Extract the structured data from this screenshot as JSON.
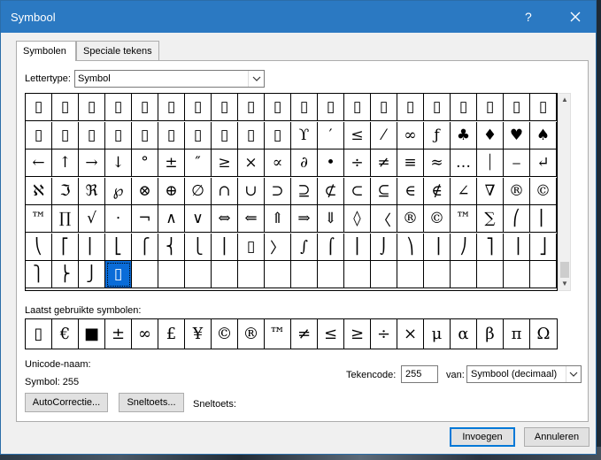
{
  "window": {
    "title": "Symbool",
    "help": "?"
  },
  "tabs": [
    {
      "label": "Symbolen",
      "active": true
    },
    {
      "label": "Speciale tekens",
      "active": false
    }
  ],
  "font": {
    "label": "Lettertype:",
    "value": "Symbol"
  },
  "grid": {
    "rows": [
      [
        "▯",
        "▯",
        "▯",
        "▯",
        "▯",
        "▯",
        "▯",
        "▯",
        "▯",
        "▯",
        "▯",
        "▯",
        "▯",
        "▯",
        "▯",
        "▯",
        "▯",
        "▯",
        "▯",
        "▯"
      ],
      [
        "▯",
        "▯",
        "▯",
        "▯",
        "▯",
        "▯",
        "▯",
        "▯",
        "▯",
        "▯",
        "ϒ",
        "′",
        "≤",
        "⁄",
        "∞",
        "ƒ",
        "♣",
        "♦",
        "♥",
        "♠",
        "↔"
      ],
      [
        "←",
        "↑",
        "→",
        "↓",
        "°",
        "±",
        "″",
        "≥",
        "×",
        "∝",
        "∂",
        "•",
        "÷",
        "≠",
        "≡",
        "≈",
        "…",
        "⏐",
        "⎯",
        "↵"
      ],
      [
        "ℵ",
        "ℑ",
        "ℜ",
        "℘",
        "⊗",
        "⊕",
        "∅",
        "∩",
        "∪",
        "⊃",
        "⊇",
        "⊄",
        "⊂",
        "⊆",
        "∈",
        "∉",
        "∠",
        "∇",
        "®",
        "©"
      ],
      [
        "™",
        "∏",
        "√",
        "⋅",
        "¬",
        "∧",
        "∨",
        "⇔",
        "⇐",
        "⇑",
        "⇒",
        "⇓",
        "◊",
        "〈",
        "®",
        "©",
        "™",
        "∑",
        "⎛",
        "⎜"
      ],
      [
        "⎝",
        "⎡",
        "⎢",
        "⎣",
        "⎧",
        "⎨",
        "⎩",
        "⎪",
        "▯",
        "〉",
        "∫",
        "⌠",
        "⎮",
        "⌡",
        "⎞",
        "⎟",
        "⎠",
        "⎤",
        "⎥",
        "⎦"
      ],
      [
        "⎫",
        "⎬",
        "⎭",
        "▯",
        "",
        "",
        "",
        "",
        "",
        "",
        "",
        "",
        "",
        "",
        "",
        "",
        "",
        "",
        "",
        ""
      ]
    ],
    "selected": {
      "row": 6,
      "col": 3
    }
  },
  "recent": {
    "label": "Laatst gebruikte symbolen:",
    "symbols": [
      "▯",
      "€",
      "■",
      "±",
      "∞",
      "£",
      "¥",
      "©",
      "®",
      "™",
      "≠",
      "≤",
      "≥",
      "÷",
      "×",
      "μ",
      "α",
      "β",
      "π",
      "Ω"
    ]
  },
  "info": {
    "unicode_name_label": "Unicode-naam:",
    "symbol_line": "Symbol: 255",
    "tekencode_label": "Tekencode:",
    "tekencode_value": "255",
    "van_label": "van:",
    "van_value": "Symbool (decimaal)",
    "sneltoets_label": "Sneltoets:"
  },
  "buttons": {
    "autocorrect": "AutoCorrectie...",
    "shortcut": "Sneltoets...",
    "insert": "Invoegen",
    "cancel": "Annuleren"
  }
}
